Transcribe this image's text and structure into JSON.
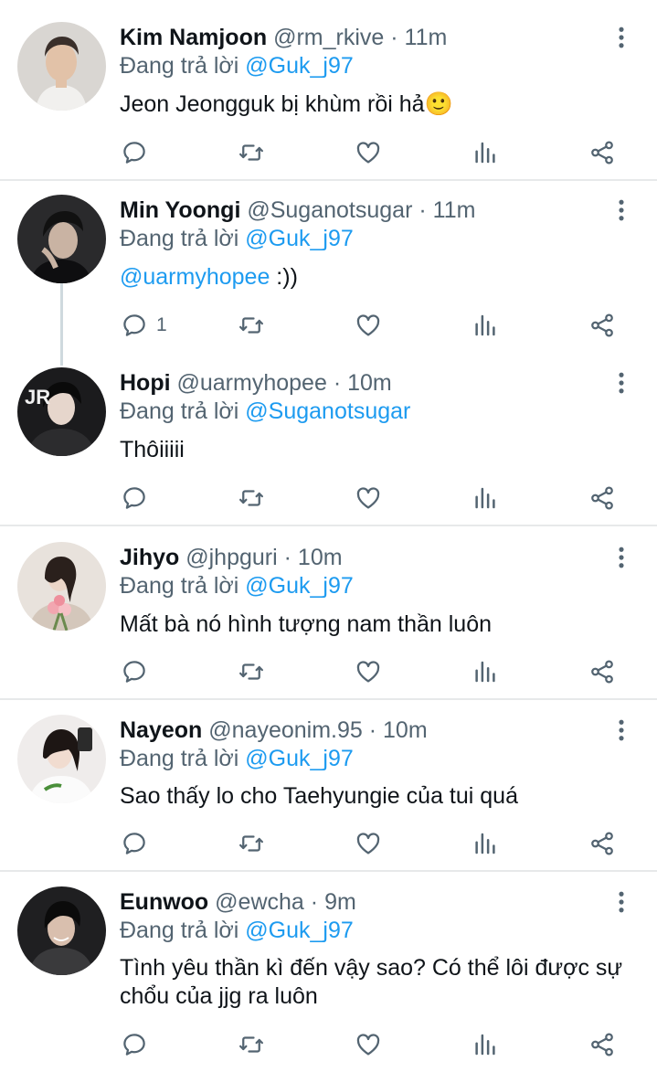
{
  "colors": {
    "link": "#1d9bf0",
    "secondary": "#536471",
    "text": "#0f1419",
    "divider": "#e7e9ea"
  },
  "icons": [
    "reply-icon",
    "retweet-icon",
    "like-icon",
    "analytics-icon",
    "share-icon",
    "more-icon"
  ],
  "tweets": [
    {
      "name": "Kim Namjoon",
      "handle": "@rm_rkive",
      "time": "11m",
      "reply_prefix": "Đang trả lời",
      "reply_to": "@Guk_j97",
      "text": "Jeon Jeongguk bị khùm rồi hả",
      "emoji": "🙂",
      "reply_count": ""
    },
    {
      "name": "Min Yoongi",
      "handle": "@Suganotsugar",
      "time": "11m",
      "reply_prefix": "Đang trả lời",
      "reply_to": "@Guk_j97",
      "text_mention": "@uarmyhopee",
      "text": " :))",
      "reply_count": "1"
    },
    {
      "name": "Hopi",
      "handle": "@uarmyhopee",
      "time": "10m",
      "reply_prefix": "Đang trả lời",
      "reply_to": "@Suganotsugar",
      "text": "Thôiiiii",
      "reply_count": ""
    },
    {
      "name": "Jihyo",
      "handle": "@jhpguri",
      "time": "10m",
      "reply_prefix": "Đang trả lời",
      "reply_to": "@Guk_j97",
      "text": "Mất bà nó hình tượng nam thần luôn",
      "reply_count": ""
    },
    {
      "name": "Nayeon",
      "handle": "@nayeonim.95",
      "time": "10m",
      "reply_prefix": "Đang trả lời",
      "reply_to": "@Guk_j97",
      "text": "Sao thấy lo cho Taehyungie của tui quá",
      "reply_count": ""
    },
    {
      "name": "Eunwoo",
      "handle": "@ewcha",
      "time": "9m",
      "reply_prefix": "Đang trả lời",
      "reply_to": "@Guk_j97",
      "text": "Tình yêu thần kì đến vậy sao? Có thể lôi được sự chổu của jjg ra luôn",
      "reply_count": ""
    }
  ]
}
